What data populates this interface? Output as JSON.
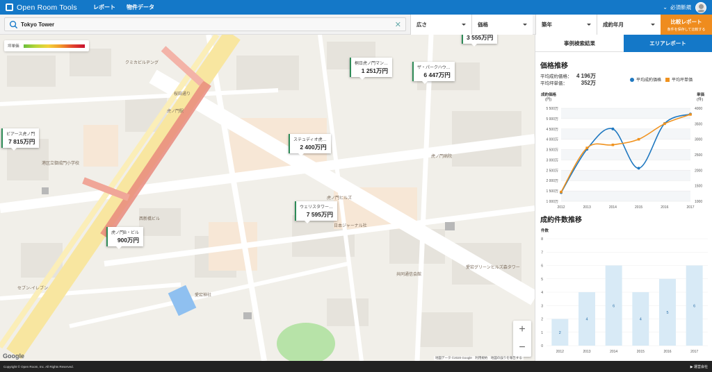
{
  "app": {
    "brand": "Open Room Tools",
    "nav": [
      "レポート",
      "物件データ"
    ],
    "user_name": "必須新規"
  },
  "search": {
    "value": "Tokyo Tower",
    "placeholder": ""
  },
  "filters": [
    {
      "label": "広さ"
    },
    {
      "label": "価格"
    },
    {
      "label": "築年"
    },
    {
      "label": "成約年月"
    }
  ],
  "cta": {
    "title": "比較レポート",
    "subtitle": "条件を保存して比較する"
  },
  "map": {
    "legend_label": "坪単価",
    "markers": [
      {
        "name": "",
        "price": "3 555万円"
      },
      {
        "name": "桐日虎ノ門マン…",
        "price": "1 251万円"
      },
      {
        "name": "ザ・パークハウ…",
        "price": "6 447万円"
      },
      {
        "name": "ビアース虎ノ門",
        "price": "7 815万円"
      },
      {
        "name": "ステュディオ虎…",
        "price": "2 400万円"
      },
      {
        "name": "ウェリスタワー…",
        "price": "7 595万円"
      },
      {
        "name": "虎ノ門B・ビル",
        "price": "900万円"
      }
    ],
    "labels": [
      "クミカビルヂング",
      "虎ノ門ヒルズ",
      "日本ジャーナル社",
      "愛宕グリーンヒルズ森タワー",
      "セブン-イレブン",
      "虎ノ門病院",
      "港区立御成門小学校",
      "愛宕神社",
      "共同通信会館",
      "西新橋ビル",
      "桜田通り",
      "虎ノ門駅"
    ],
    "google": "Google",
    "credit": "地図データ ©2020 Google　利用規約　地図の誤りを報告する",
    "zoom_in": "+",
    "zoom_out": "−"
  },
  "panel": {
    "tabs": [
      "事例検索結果",
      "エリアレポート"
    ],
    "price_section": "価格推移",
    "stats": [
      {
        "label": "平均成約価格：",
        "value": "4 196万"
      },
      {
        "label": "平均坪単価：",
        "value": "352万"
      }
    ],
    "legend": [
      "平均成約価格",
      "平均坪単価"
    ],
    "count_section": "成約件数推移",
    "colors": {
      "blue": "#1f78c0",
      "orange": "#f0921e",
      "bar": "#d8eaf6"
    }
  },
  "chart_data": [
    {
      "type": "line",
      "title": "",
      "x": [
        2012,
        2013,
        2014,
        2015,
        2016,
        2017
      ],
      "series": [
        {
          "name": "平均成約価格",
          "axis": "left",
          "values": [
            1420,
            3520,
            4500,
            2600,
            4760,
            5220
          ]
        },
        {
          "name": "平均坪単価",
          "axis": "right",
          "values": [
            130,
            272,
            282,
            300,
            350,
            380
          ]
        }
      ],
      "ylabel_left": "成約価格\n(円)",
      "ylabel_right": "単価\n(件)",
      "yticks_left": [
        "5 500万",
        "5 000万",
        "4 500万",
        "4 000万",
        "3 500万",
        "3 000万",
        "2 500万",
        "2 000万",
        "1 500万",
        "1 000万"
      ],
      "yticks_right": [
        "4000",
        "3500",
        "3000",
        "2500",
        "2000",
        "1500",
        "1000"
      ],
      "ylim_left": [
        1000,
        5500
      ],
      "ylim_right": [
        100,
        400
      ],
      "grid": true
    },
    {
      "type": "bar",
      "title": "",
      "categories": [
        2012,
        2013,
        2014,
        2015,
        2016,
        2017
      ],
      "values": [
        2,
        4,
        6,
        4,
        5,
        6
      ],
      "ylabel": "件数",
      "yticks": [
        "8",
        "7",
        "6",
        "5",
        "4",
        "3",
        "2",
        "1",
        "0"
      ],
      "ylim": [
        0,
        8
      ]
    }
  ],
  "footer": {
    "copyright": "Copyright © Open Room, Inc. All Rights Reserved.",
    "link": "▶ 運営会社"
  }
}
